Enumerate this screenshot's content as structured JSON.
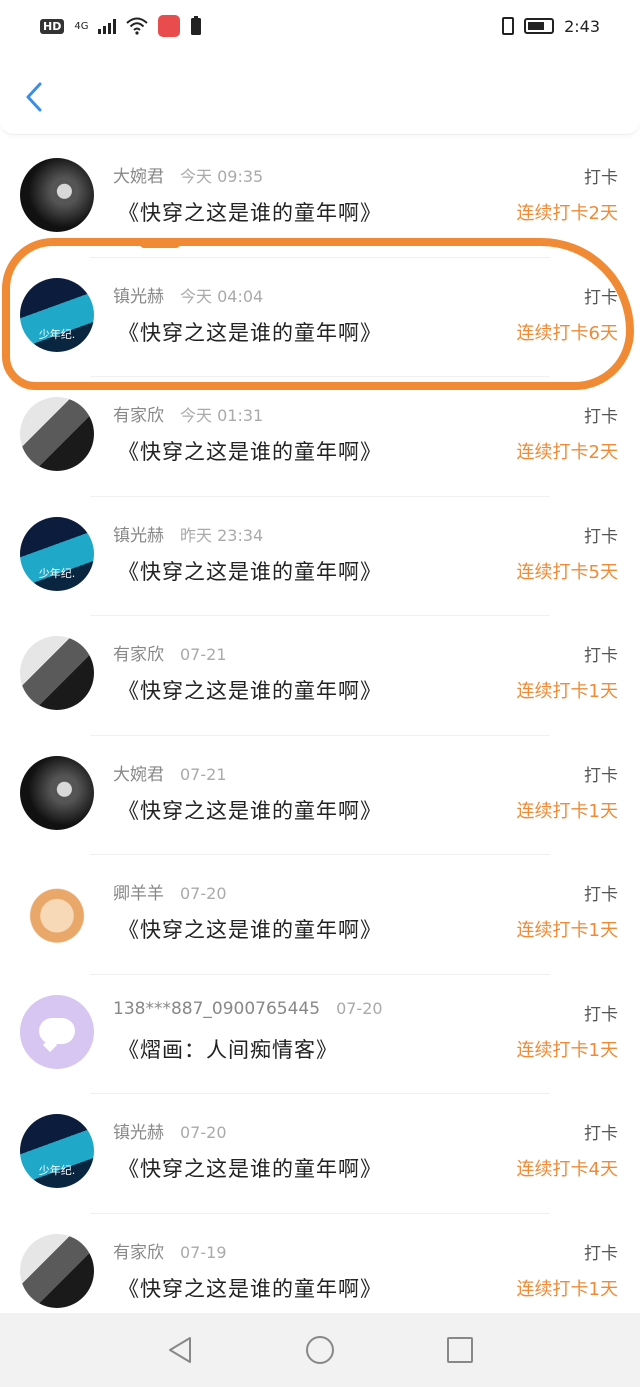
{
  "status_bar": {
    "hd": "HD",
    "network": "4G",
    "time": "2:43"
  },
  "records": [
    {
      "user": "大婉君",
      "time": "今天 09:35",
      "book": "《快穿之这是谁的童年啊》",
      "tag": "打卡",
      "streak": "连续打卡2天",
      "avatar": "dandelion-avatar",
      "caption": ""
    },
    {
      "user": "镇光赫",
      "time": "今天 04:04",
      "book": "《快穿之这是谁的童年啊》",
      "tag": "打卡",
      "streak": "连续打卡6天",
      "avatar": "sunglasses-avatar",
      "caption": "少年纪."
    },
    {
      "user": "有家欣",
      "time": "今天 01:31",
      "book": "《快穿之这是谁的童年啊》",
      "tag": "打卡",
      "streak": "连续打卡2天",
      "avatar": "man-portrait-avatar",
      "caption": ""
    },
    {
      "user": "镇光赫",
      "time": "昨天 23:34",
      "book": "《快穿之这是谁的童年啊》",
      "tag": "打卡",
      "streak": "连续打卡5天",
      "avatar": "sunglasses-avatar",
      "caption": "少年纪."
    },
    {
      "user": "有家欣",
      "time": "07-21",
      "book": "《快穿之这是谁的童年啊》",
      "tag": "打卡",
      "streak": "连续打卡1天",
      "avatar": "man-portrait-avatar",
      "caption": ""
    },
    {
      "user": "大婉君",
      "time": "07-21",
      "book": "《快穿之这是谁的童年啊》",
      "tag": "打卡",
      "streak": "连续打卡1天",
      "avatar": "dandelion-avatar",
      "caption": ""
    },
    {
      "user": "卿羊羊",
      "time": "07-20",
      "book": "《快穿之这是谁的童年啊》",
      "tag": "打卡",
      "streak": "连续打卡1天",
      "avatar": "flower-avatar",
      "caption": ""
    },
    {
      "user": "138***887_0900765445",
      "time": "07-20",
      "book": "《熠画：人间痴情客》",
      "tag": "打卡",
      "streak": "连续打卡1天",
      "avatar": "chat-bubble-avatar",
      "caption": ""
    },
    {
      "user": "镇光赫",
      "time": "07-20",
      "book": "《快穿之这是谁的童年啊》",
      "tag": "打卡",
      "streak": "连续打卡4天",
      "avatar": "sunglasses-avatar",
      "caption": "少年纪."
    },
    {
      "user": "有家欣",
      "time": "07-19",
      "book": "《快穿之这是谁的童年啊》",
      "tag": "打卡",
      "streak": "连续打卡1天",
      "avatar": "man-portrait-avatar",
      "caption": ""
    }
  ],
  "colors": {
    "accent": "#f08a35",
    "back_arrow": "#3a8ee6"
  }
}
